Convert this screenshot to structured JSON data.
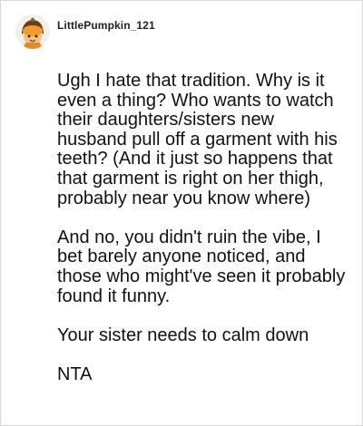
{
  "comment": {
    "author": {
      "username": "LittlePumpkin_121",
      "avatar_icon": "pumpkin-avatar-icon"
    },
    "paragraphs": [
      "Ugh I hate that tradition. Why is it even a thing? Who wants to watch their daughters/sisters new husband pull off a garment with his teeth? (And it just so happens that that garment is right on her thigh, probably near you know where)",
      "And no, you didn't ruin the vibe, I bet barely anyone noticed, and those who might've seen it probably found it funny.",
      "Your sister needs to calm down",
      "NTA"
    ]
  },
  "colors": {
    "border": "#d9d9d9",
    "text": "#111111",
    "username": "#222222"
  }
}
